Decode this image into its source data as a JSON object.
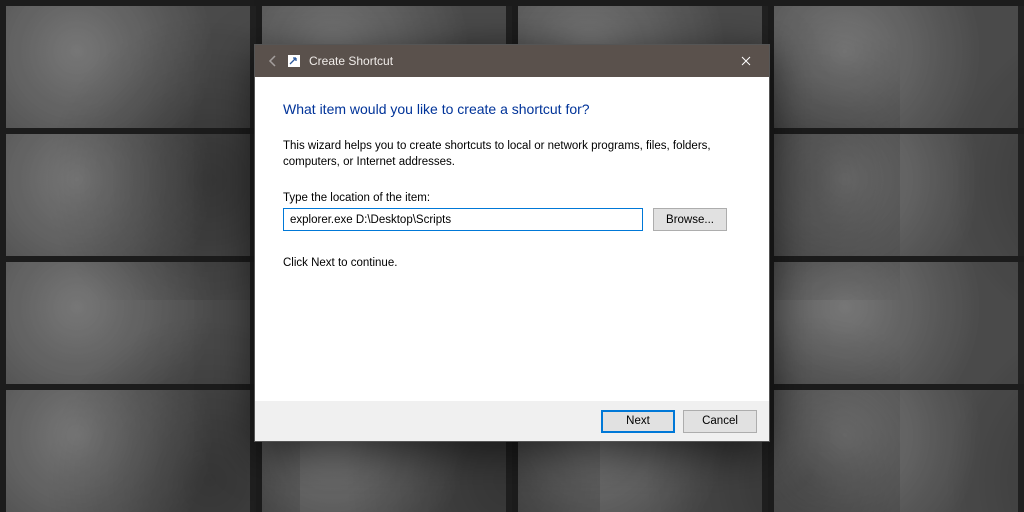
{
  "titlebar": {
    "title": "Create Shortcut"
  },
  "wizard": {
    "heading": "What item would you like to create a shortcut for?",
    "description": "This wizard helps you to create shortcuts to local or network programs, files, folders, computers, or Internet addresses.",
    "location_label": "Type the location of the item:",
    "location_value": "explorer.exe D:\\Desktop\\Scripts",
    "browse_label": "Browse...",
    "instruction": "Click Next to continue."
  },
  "footer": {
    "next_label": "Next",
    "cancel_label": "Cancel"
  }
}
